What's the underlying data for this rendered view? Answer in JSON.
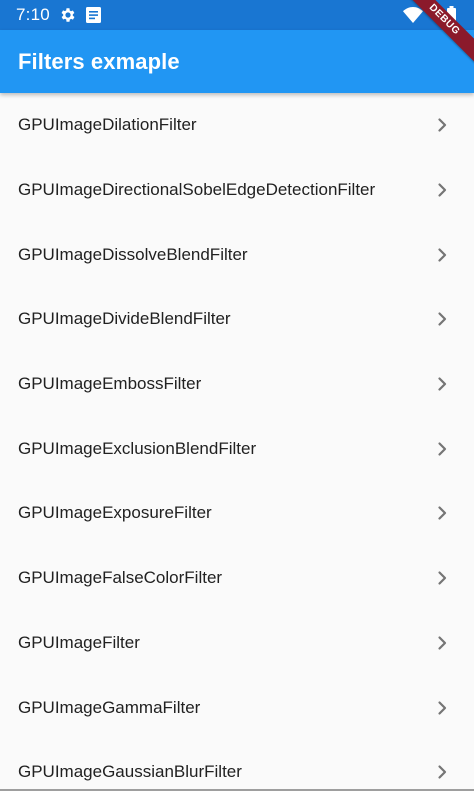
{
  "status_bar": {
    "time": "7:10",
    "icons": [
      "gear-icon",
      "notes-icon",
      "wifi-icon",
      "battery-icon"
    ]
  },
  "app_bar": {
    "title": "Filters exmaple"
  },
  "debug_banner": {
    "label": "DEBUG"
  },
  "filters": [
    "GPUImageDilationFilter",
    "GPUImageDirectionalSobelEdgeDetectionFilter",
    "GPUImageDissolveBlendFilter",
    "GPUImageDivideBlendFilter",
    "GPUImageEmbossFilter",
    "GPUImageExclusionBlendFilter",
    "GPUImageExposureFilter",
    "GPUImageFalseColorFilter",
    "GPUImageFilter",
    "GPUImageGammaFilter",
    "GPUImageGaussianBlurFilter"
  ],
  "colors": {
    "status_bar": "#1976d2",
    "app_bar": "#2196f3",
    "background": "#fafafa",
    "text": "#212121",
    "chevron": "#757575",
    "debug_ribbon": "#8b1a2b"
  }
}
